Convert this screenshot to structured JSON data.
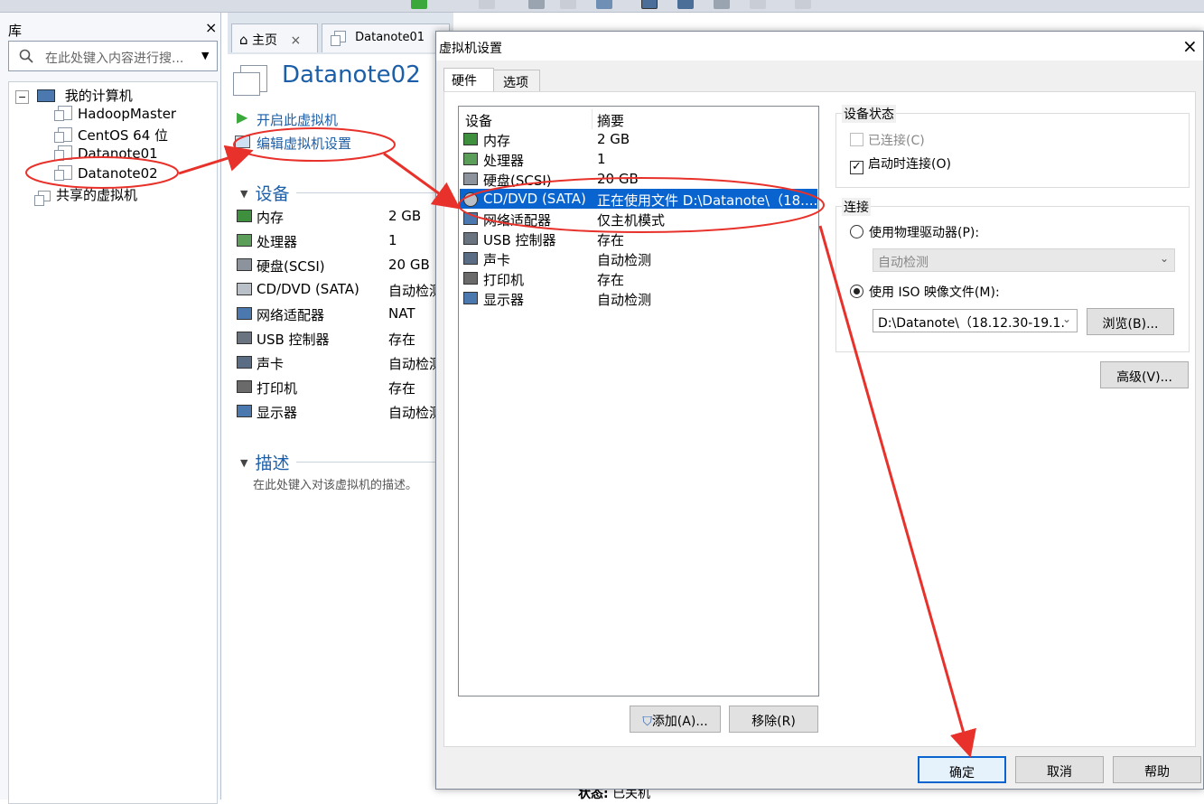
{
  "library": {
    "title": "库",
    "close": "×",
    "search_placeholder": "在此处键入内容进行搜...",
    "tree": {
      "root": "我的计算机",
      "vms": [
        "HadoopMaster",
        "CentOS 64 位",
        "Datanote01",
        "Datanote02"
      ],
      "shared": "共享的虚拟机"
    }
  },
  "tabs": [
    {
      "label": "主页",
      "close": "×"
    },
    {
      "label": "Datanote01"
    }
  ],
  "vm": {
    "name": "Datanote02",
    "actions": {
      "power_on": "开启此虚拟机",
      "edit": "编辑虚拟机设置"
    },
    "devices_section": "设备",
    "devices": [
      {
        "name": "内存",
        "value": "2 GB"
      },
      {
        "name": "处理器",
        "value": "1"
      },
      {
        "name": "硬盘(SCSI)",
        "value": "20 GB"
      },
      {
        "name": "CD/DVD (SATA)",
        "value": "自动检测"
      },
      {
        "name": "网络适配器",
        "value": "NAT"
      },
      {
        "name": "USB 控制器",
        "value": "存在"
      },
      {
        "name": "声卡",
        "value": "自动检测"
      },
      {
        "name": "打印机",
        "value": "存在"
      },
      {
        "name": "显示器",
        "value": "自动检测"
      }
    ],
    "desc_section": "描述",
    "desc_placeholder": "在此处键入对该虚拟机的描述。",
    "status_label": "状态:",
    "status_value": "已关机"
  },
  "dialog": {
    "title": "虚拟机设置",
    "close": "×",
    "tabs": [
      "硬件",
      "选项"
    ],
    "list_headers": [
      "设备",
      "摘要"
    ],
    "hardware": [
      {
        "device": "内存",
        "summary": "2 GB"
      },
      {
        "device": "处理器",
        "summary": "1"
      },
      {
        "device": "硬盘(SCSI)",
        "summary": "20 GB"
      },
      {
        "device": "CD/DVD (SATA)",
        "summary": "正在使用文件 D:\\Datanote\\（18...."
      },
      {
        "device": "网络适配器",
        "summary": "仅主机模式"
      },
      {
        "device": "USB 控制器",
        "summary": "存在"
      },
      {
        "device": "声卡",
        "summary": "自动检测"
      },
      {
        "device": "打印机",
        "summary": "存在"
      },
      {
        "device": "显示器",
        "summary": "自动检测"
      }
    ],
    "selected_index": 3,
    "add_button": "添加(A)...",
    "remove_button": "移除(R)",
    "device_status": {
      "title": "设备状态",
      "connected": "已连接(C)",
      "connect_at_power_on": "启动时连接(O)"
    },
    "connection": {
      "title": "连接",
      "physical_drive": "使用物理驱动器(P):",
      "physical_value": "自动检测",
      "iso_file": "使用 ISO 映像文件(M):",
      "iso_value": "D:\\Datanote\\（18.12.30-19.1.",
      "browse": "浏览(B)..."
    },
    "advanced": "高级(V)...",
    "ok": "确定",
    "cancel": "取消",
    "help": "帮助"
  },
  "colors": {
    "accent": "#1c5fa8",
    "selection": "#0a64d0",
    "annotation": "#e8312a"
  }
}
